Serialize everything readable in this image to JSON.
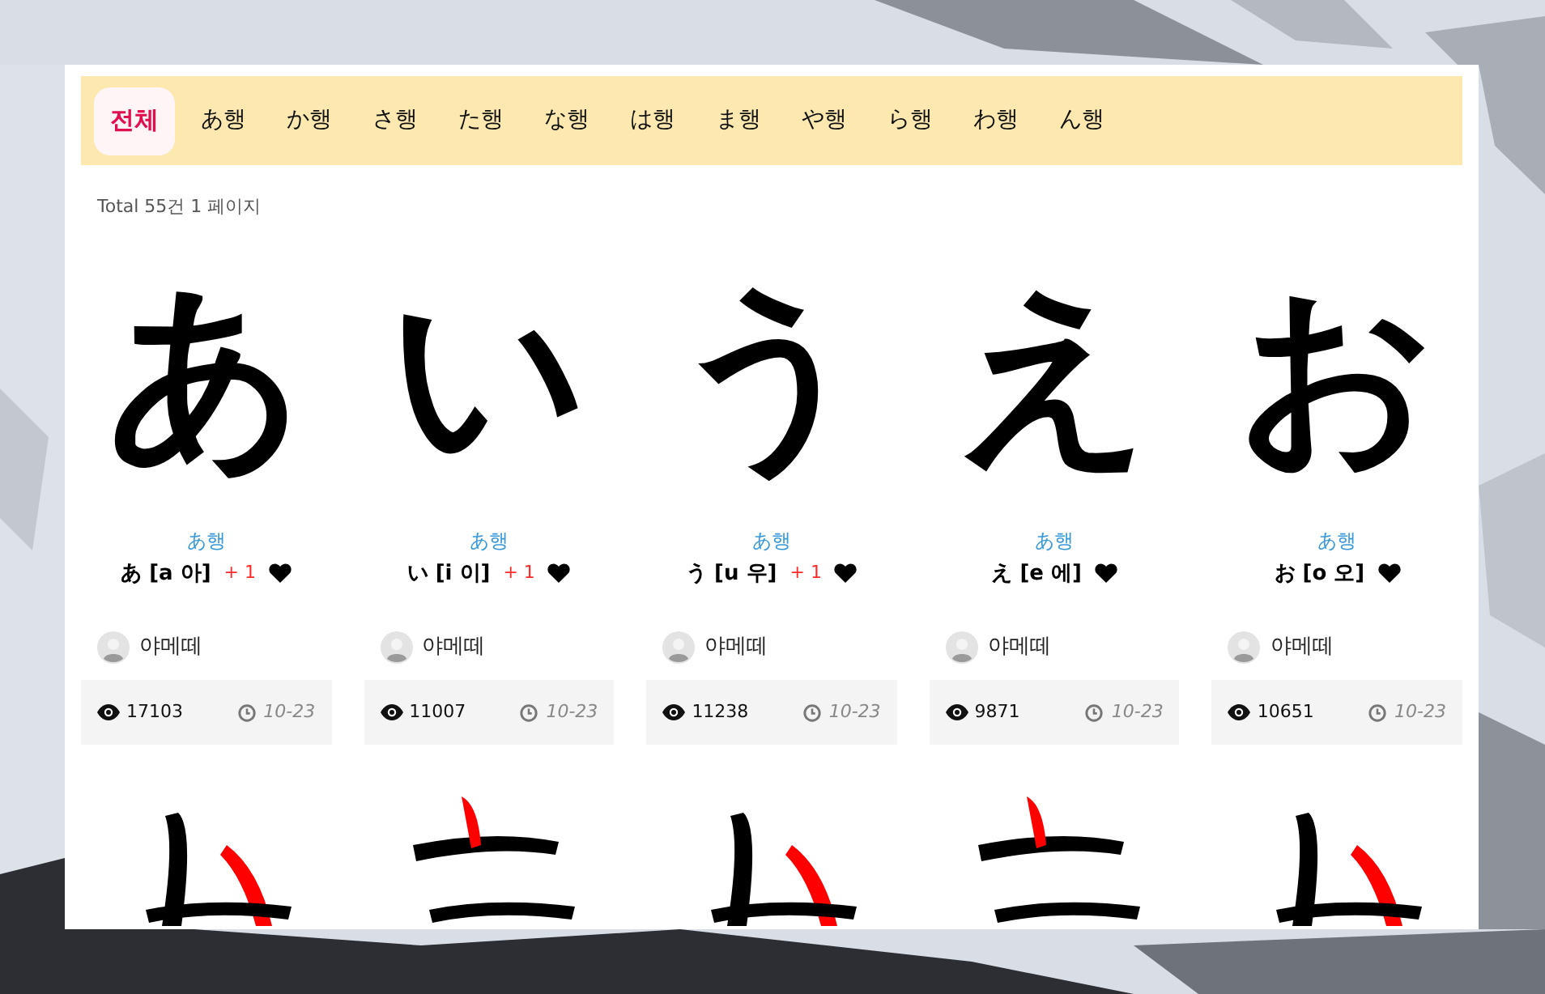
{
  "tabs": [
    {
      "label": "전체",
      "selected": true
    },
    {
      "label": "あ행",
      "selected": false
    },
    {
      "label": "か행",
      "selected": false
    },
    {
      "label": "さ행",
      "selected": false
    },
    {
      "label": "た행",
      "selected": false
    },
    {
      "label": "な행",
      "selected": false
    },
    {
      "label": "は행",
      "selected": false
    },
    {
      "label": "ま행",
      "selected": false
    },
    {
      "label": "や행",
      "selected": false
    },
    {
      "label": "ら행",
      "selected": false
    },
    {
      "label": "わ행",
      "selected": false
    },
    {
      "label": "ん행",
      "selected": false
    }
  ],
  "summary": "Total 55건 1 페이지",
  "cards": [
    {
      "glyph": "あ",
      "group": "あ행",
      "title": "あ [a 아]",
      "likes": "+ 1",
      "author": "야메떼",
      "views": "17103",
      "date": "10-23"
    },
    {
      "glyph": "い",
      "group": "あ행",
      "title": "い [i 이]",
      "likes": "+ 1",
      "author": "야메떼",
      "views": "11007",
      "date": "10-23"
    },
    {
      "glyph": "う",
      "group": "あ행",
      "title": "う [u 우]",
      "likes": "+ 1",
      "author": "야메떼",
      "views": "11238",
      "date": "10-23"
    },
    {
      "glyph": "え",
      "group": "あ행",
      "title": "え [e 에]",
      "author": "야메떼",
      "views": "9871",
      "date": "10-23"
    },
    {
      "glyph": "お",
      "group": "あ행",
      "title": "お [o 오]",
      "author": "야메떼",
      "views": "10651",
      "date": "10-23"
    }
  ]
}
